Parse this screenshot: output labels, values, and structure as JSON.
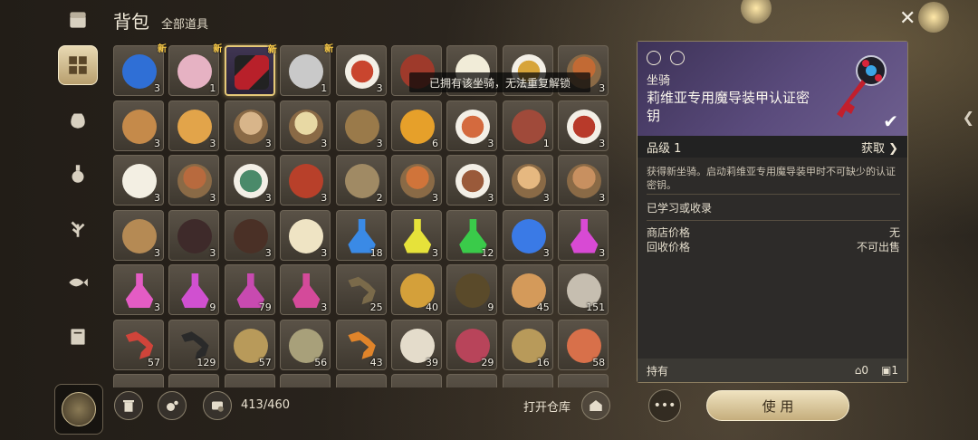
{
  "header": {
    "title": "背包",
    "subtitle": "全部道具"
  },
  "tooltip": "已拥有该坐骑，无法重复解锁",
  "rail": {
    "items": [
      {
        "icon": "chest-icon"
      },
      {
        "icon": "grid-icon",
        "active": true
      },
      {
        "icon": "bag-icon"
      },
      {
        "icon": "potion-icon"
      },
      {
        "icon": "herb-icon"
      },
      {
        "icon": "fish-icon"
      },
      {
        "icon": "book-icon"
      }
    ]
  },
  "inventory": {
    "capacity": "413/460",
    "rows": [
      [
        {
          "icon": "coral-icon",
          "color": "#2f6fd6",
          "count": "3",
          "new": "新"
        },
        {
          "icon": "shell-icon",
          "color": "#e6b2c3",
          "count": "1",
          "new": "新"
        },
        {
          "icon": "key-icon",
          "color": "#b8202a",
          "count": "",
          "new": "新",
          "selected": true
        },
        {
          "icon": "ingot-icon",
          "color": "#c9c9c9",
          "count": "1",
          "new": "新"
        },
        {
          "icon": "dish-icon",
          "color": "#c9452e",
          "count": "3"
        },
        {
          "icon": "steak-icon",
          "color": "#9e3a2b",
          "count": ""
        },
        {
          "icon": "egg-icon",
          "color": "#f1ecd8",
          "count": ""
        },
        {
          "icon": "dish-icon",
          "color": "#d7a43a",
          "count": ""
        },
        {
          "icon": "bowl-icon",
          "color": "#c26a34",
          "count": "3"
        }
      ],
      [
        {
          "icon": "bread-icon",
          "color": "#c58a4a",
          "count": "3"
        },
        {
          "icon": "pancake-icon",
          "color": "#e2a44a",
          "count": "3"
        },
        {
          "icon": "bowl-icon",
          "color": "#d8b58a",
          "count": "3"
        },
        {
          "icon": "soup-icon",
          "color": "#e8d9a4",
          "count": "3"
        },
        {
          "icon": "pot-icon",
          "color": "#9a7a4a",
          "count": "3"
        },
        {
          "icon": "oil-bottle-icon",
          "color": "#e6a02a",
          "count": "6"
        },
        {
          "icon": "dish-icon",
          "color": "#d46a3e",
          "count": "3"
        },
        {
          "icon": "steak-icon",
          "color": "#a04a3a",
          "count": "1"
        },
        {
          "icon": "dish-icon",
          "color": "#b83a2a",
          "count": "3"
        }
      ],
      [
        {
          "icon": "egg-icon",
          "color": "#f3efe3",
          "count": "3"
        },
        {
          "icon": "meat-bowl-icon",
          "color": "#b86a3e",
          "count": "3"
        },
        {
          "icon": "salad-icon",
          "color": "#4a8a6a",
          "count": "3"
        },
        {
          "icon": "lobster-icon",
          "color": "#b8402a",
          "count": "3"
        },
        {
          "icon": "fish-icon",
          "color": "#a08a64",
          "count": "2"
        },
        {
          "icon": "bowl-icon",
          "color": "#d0743a",
          "count": "3"
        },
        {
          "icon": "dish-icon",
          "color": "#9a5a3a",
          "count": "3"
        },
        {
          "icon": "pie-icon",
          "color": "#e6b880",
          "count": "3"
        },
        {
          "icon": "bowl-icon",
          "color": "#c89060",
          "count": "3"
        }
      ],
      [
        {
          "icon": "pouch-icon",
          "color": "#b58a54",
          "count": "3"
        },
        {
          "icon": "berries-icon",
          "color": "#3e2a2a",
          "count": "3"
        },
        {
          "icon": "orb-icon",
          "color": "#4a3026",
          "count": "3"
        },
        {
          "icon": "pearl-icon",
          "color": "#efe4c4",
          "count": "3"
        },
        {
          "icon": "potion-icon",
          "color": "#3a8ae6",
          "count": "18"
        },
        {
          "icon": "potion-icon",
          "color": "#e6e23a",
          "count": "3"
        },
        {
          "icon": "potion-icon",
          "color": "#3acb4a",
          "count": "12"
        },
        {
          "icon": "cup-icon",
          "color": "#3a7ae6",
          "count": "3"
        },
        {
          "icon": "potion-icon",
          "color": "#d84ad4",
          "count": "3"
        }
      ],
      [
        {
          "icon": "potion-icon",
          "color": "#e45cc4",
          "count": "3"
        },
        {
          "icon": "potion-icon",
          "color": "#d050d0",
          "count": "9"
        },
        {
          "icon": "potion-icon",
          "color": "#c84ab0",
          "count": "79"
        },
        {
          "icon": "potion-icon",
          "color": "#d44a9a",
          "count": "3"
        },
        {
          "icon": "worm-icon",
          "color": "#7a6a4a",
          "count": "25"
        },
        {
          "icon": "larva-icon",
          "color": "#d4a03a",
          "count": "40"
        },
        {
          "icon": "beetle-icon",
          "color": "#5a4a2a",
          "count": "9"
        },
        {
          "icon": "ball-icon",
          "color": "#d49a5a",
          "count": "45"
        },
        {
          "icon": "ball-icon",
          "color": "#c6beb0",
          "count": "151"
        }
      ],
      [
        {
          "icon": "worm-icon",
          "color": "#d0443a",
          "count": "57"
        },
        {
          "icon": "coil-icon",
          "color": "#2a2a2a",
          "count": "129"
        },
        {
          "icon": "cage-icon",
          "color": "#b89a5a",
          "count": "57"
        },
        {
          "icon": "ball-icon",
          "color": "#a8a07a",
          "count": "56"
        },
        {
          "icon": "worm-icon",
          "color": "#e0842a",
          "count": "43"
        },
        {
          "icon": "ball-icon",
          "color": "#e4dccb",
          "count": "39"
        },
        {
          "icon": "leaf-icon",
          "color": "#b8445a",
          "count": "29"
        },
        {
          "icon": "cage-icon",
          "color": "#b89a5a",
          "count": "16"
        },
        {
          "icon": "ball-icon",
          "color": "#d8704a",
          "count": "58"
        }
      ]
    ]
  },
  "bottom": {
    "open_warehouse": "打开仓库",
    "more": "•••",
    "use": "使 用"
  },
  "detail": {
    "type": "坐骑",
    "name": "莉维亚专用魔导装甲认证密钥",
    "grade_label": "品级 1",
    "obtain_label": "获取",
    "description": "获得新坐骑。启动莉维亚专用魔导装甲时不可缺少的认证密钥。",
    "learned": "已学习或收录",
    "shop_price_label": "商店价格",
    "shop_price_value": "无",
    "recycle_price_label": "回收价格",
    "recycle_price_value": "不可出售",
    "hold_label": "持有",
    "hold_home": "0",
    "hold_bag": "1",
    "accent_color": "#5a4b7c"
  }
}
